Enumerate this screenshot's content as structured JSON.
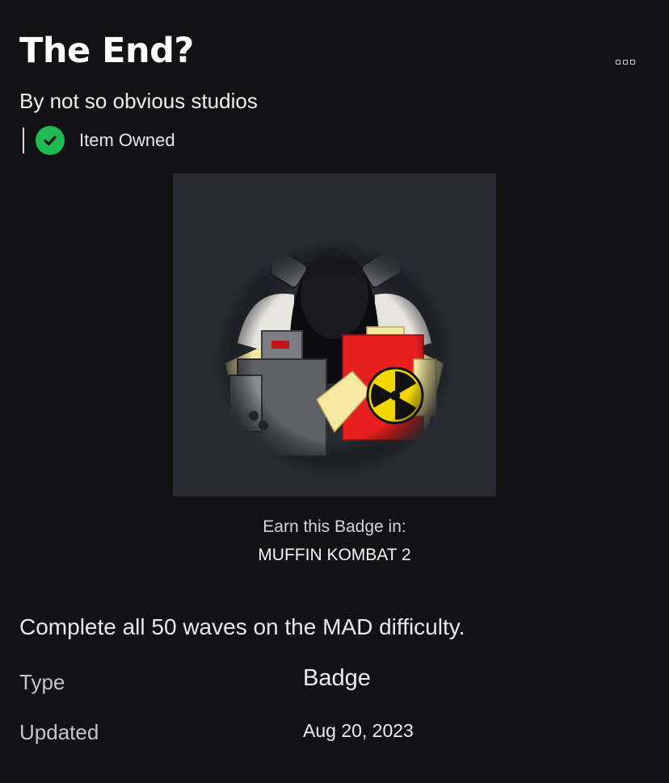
{
  "item": {
    "title": "The End?",
    "creator_line": "By not so obvious studios",
    "owned_label": "Item Owned",
    "more_icon": "more-options-icon"
  },
  "badge": {
    "image_icon": "badge-thumbnail",
    "earn_label": "Earn this Badge in:",
    "game_name": "MUFFIN KOMBAT 2",
    "description": "Complete all 50 waves on the MAD difficulty."
  },
  "details": {
    "type_label": "Type",
    "type_value": "Badge",
    "updated_label": "Updated",
    "updated_value": "Aug 20, 2023"
  },
  "colors": {
    "background": "#121215",
    "owned_green": "#1fbb52",
    "image_frame": "#272a31"
  }
}
